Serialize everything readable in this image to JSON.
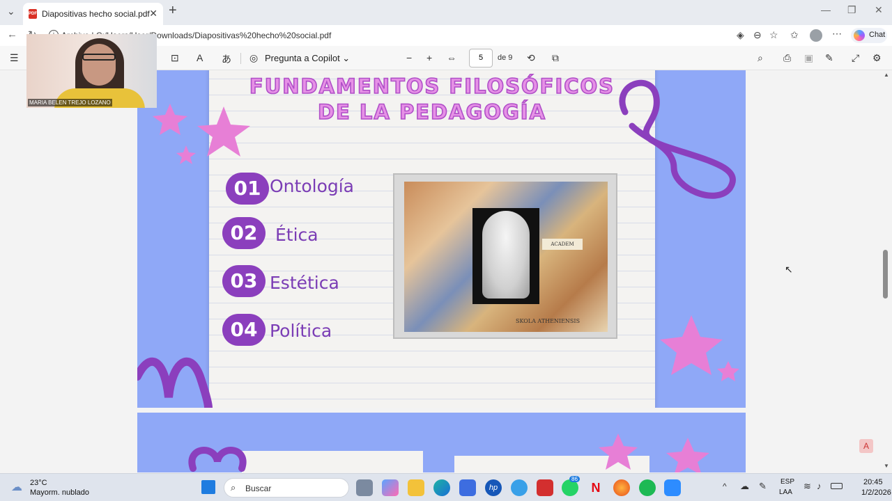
{
  "browser": {
    "tab_title": "Diapositivas hecho social.pdf",
    "address_prefix": "Archivo",
    "url": "C:/Users/User/Downloads/Diapositivas%20hecho%20social.pdf",
    "chat_label": "Chat"
  },
  "pdf_toolbar": {
    "copilot_label": "Pregunta a Copilot",
    "current_page": "5",
    "page_total": "de 9"
  },
  "slide": {
    "title_line1": "FUNDAMENTOS FILOSÓFICOS",
    "title_line2": "DE LA PEDAGOGÍA",
    "items": [
      {
        "num": "01",
        "label": "Ontología"
      },
      {
        "num": "02",
        "label": "Ética"
      },
      {
        "num": "03",
        "label": "Estética"
      },
      {
        "num": "04",
        "label": "Política"
      }
    ],
    "image_caption": "SKOLA ATHENIENSIS",
    "image_sign": "ACADEM"
  },
  "webcam": {
    "participant_name": "MARIA BELEN TREJO LOZANO"
  },
  "taskbar": {
    "temperature": "23°C",
    "weather": "Mayorm. nublado",
    "search_placeholder": "Buscar",
    "badge_count": "86",
    "language1": "ESP",
    "language2": "LAA",
    "time": "20:45",
    "date": "1/2/2026"
  },
  "colors": {
    "slide_bg": "#8fa8f7",
    "accent_purple": "#8b3fbd",
    "title_pink": "#e691e6",
    "star_pink": "#e77fd6"
  }
}
